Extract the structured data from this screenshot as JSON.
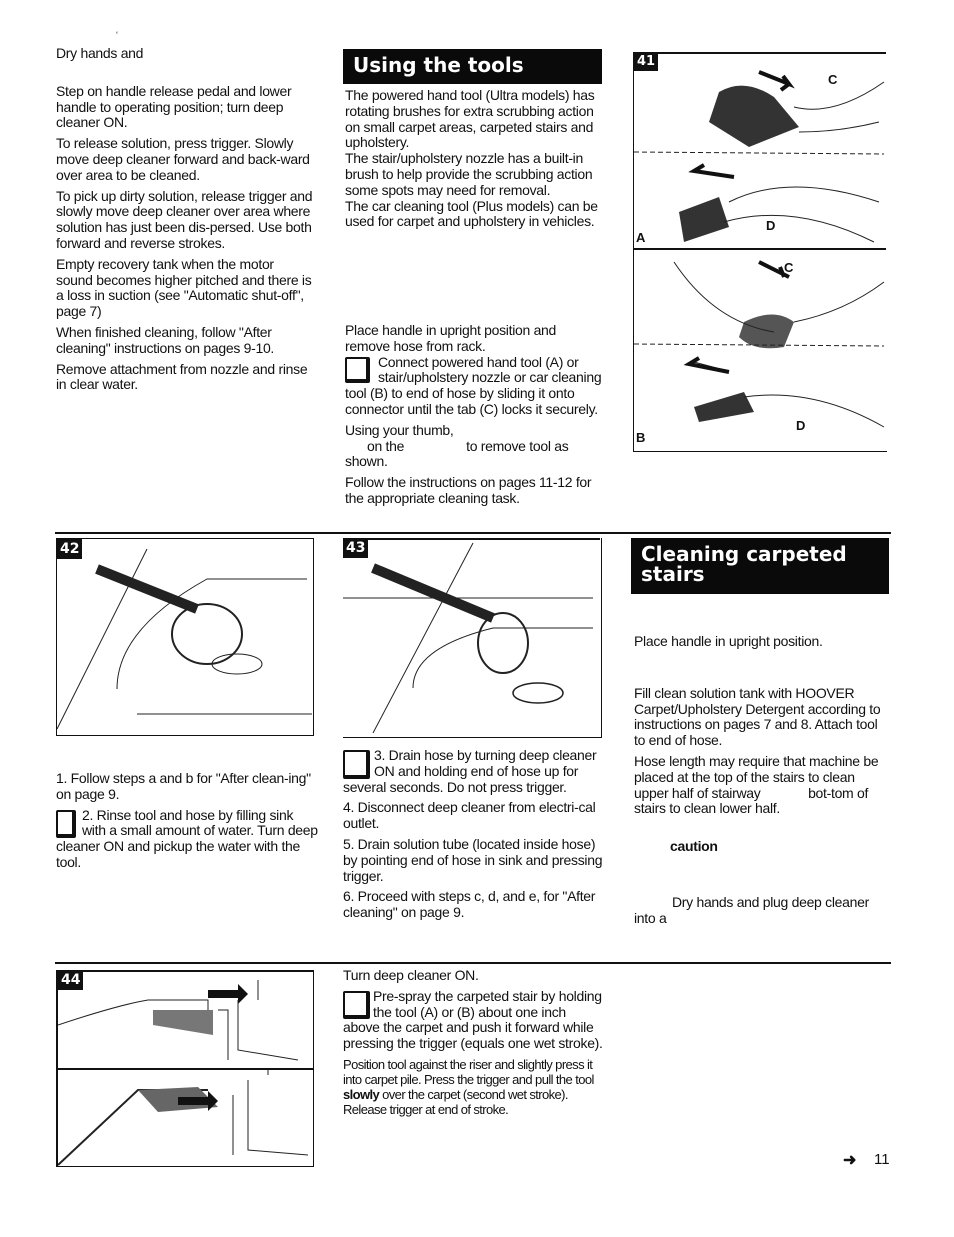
{
  "col1_top": {
    "mark": "ʻ",
    "paragraphs": [
      "Dry hands and",
      "Step on handle release pedal and lower handle to operating position; turn deep cleaner ON.",
      "To release solution, press trigger. Slowly move deep cleaner forward and back-ward over area to be cleaned.",
      "To pick up dirty solution, release trigger and slowly move deep cleaner over area where solution has just been dis-persed. Use both forward and reverse strokes.",
      "Empty recovery tank when the motor sound becomes higher pitched and there is a loss in suction (see \"Automatic shut-off\", page 7)",
      "When finished cleaning, follow \"After cleaning\" instructions on pages 9-10.",
      "Remove attachment from nozzle and rinse in clear water."
    ]
  },
  "using_tools": {
    "heading": "Using the tools",
    "intro": [
      "The powered hand tool (Ultra models) has rotating brushes for extra scrubbing action on small carpet areas, carpeted stairs and upholstery.",
      "The stair/upholstery nozzle has a built-in brush to help provide the scrubbing action some spots may need for removal.",
      "The car cleaning tool (Plus models) can be used for carpet and upholstery in vehicles."
    ],
    "place": "Place handle in upright position and remove hose from rack.",
    "connect": "Connect powered hand tool (A) or stair/upholstery nozzle or car cleaning tool (B) to end of hose by sliding it onto connector until the tab (C) locks it securely.",
    "thumb_1": "Using your thumb,",
    "thumb_2": "on the",
    "thumb_3": "to remove tool as",
    "thumb_4": "shown.",
    "follow": "Follow the instructions on pages 11-12 for the appropriate cleaning task."
  },
  "figures": {
    "fig41": {
      "number": "41",
      "labels": {
        "c1": "C",
        "d1": "D",
        "a": "A",
        "c2": "C",
        "d2": "D",
        "b": "B"
      }
    },
    "fig42": {
      "number": "42"
    },
    "fig43": {
      "number": "43"
    },
    "fig44": {
      "number": "44"
    }
  },
  "rinse": {
    "step1": "1. Follow steps a and b for \"After clean-ing\" on page 9.",
    "step2": "2. Rinse tool and hose by filling sink with a small amount of water. Turn deep cleaner ON and pickup the water with the tool.",
    "step3": "3. Drain hose by turning deep cleaner ON and holding end of hose up for several seconds. Do not press trigger.",
    "step4": "4. Disconnect deep cleaner from electri-cal outlet.",
    "step5": "5. Drain solution tube (located inside hose) by pointing end of hose in sink and pressing trigger.",
    "step6": "6. Proceed with steps c, d, and e, for \"After cleaning\" on page 9."
  },
  "stairs": {
    "heading": "Cleaning carpeted stairs",
    "place": "Place handle in upright position.",
    "fill": "Fill clean solution tank with HOOVER Carpet/Upholstery Detergent according to instructions on pages 7 and 8. Attach tool to end of hose.",
    "hose": "Hose length may require that machine be placed at the top of the stairs to clean upper half of stairway",
    "hose_end": "bot-tom of stairs to clean lower half.",
    "caution": "caution",
    "dry": "Dry hands and plug deep cleaner into a"
  },
  "bottom": {
    "turn_on": "Turn deep cleaner ON.",
    "prespray": "Pre-spray the carpeted stair by holding the tool (A) or (B) about one inch above the carpet and push it forward while pressing the trigger (equals one wet stroke).",
    "position_1": "Position tool against the riser and slightly press it into carpet pile. Press the trigger and pull the tool",
    "position_bold": "slowly",
    "position_2": "over the carpet (second wet stroke). Release trigger at end of stroke."
  },
  "footer": {
    "arrow_icon": "right-arrow",
    "page_number": "11"
  }
}
